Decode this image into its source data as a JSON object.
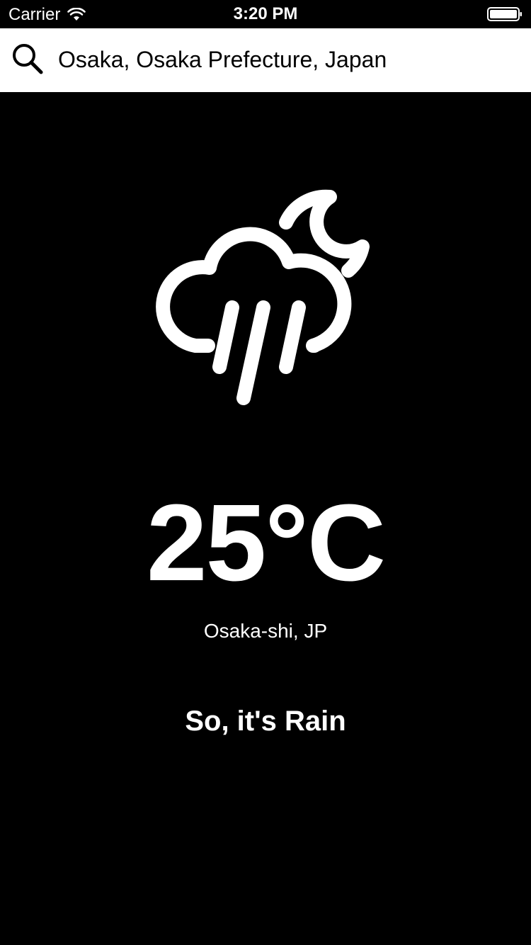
{
  "status_bar": {
    "carrier": "Carrier",
    "time": "3:20 PM",
    "wifi_icon": "wifi-icon",
    "battery_icon": "battery-icon"
  },
  "search": {
    "icon": "search-icon",
    "value": "Osaka, Osaka Prefecture, Japan",
    "placeholder": ""
  },
  "weather": {
    "icon": "rain-cloud-moon-icon",
    "temperature": "25°C",
    "location": "Osaka-shi, JP",
    "condition_text": "So, it's Rain"
  },
  "colors": {
    "background": "#000000",
    "foreground": "#ffffff",
    "search_bar_bg": "#ffffff"
  }
}
